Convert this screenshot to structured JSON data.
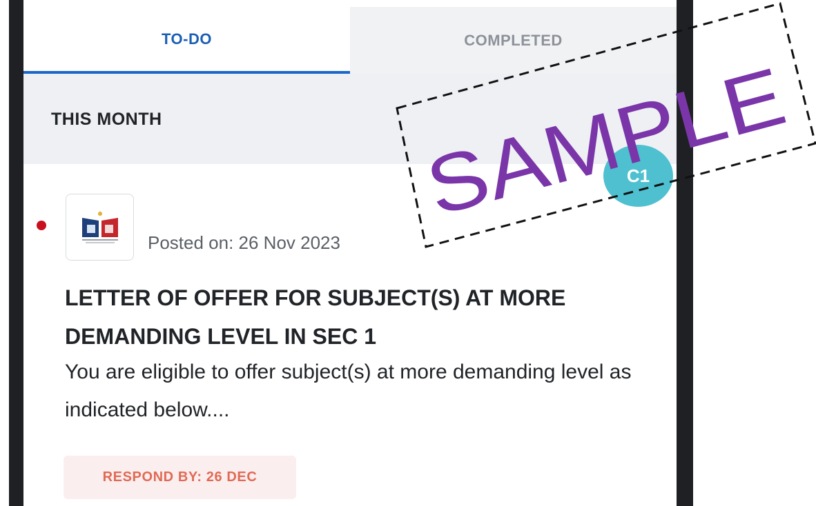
{
  "tabs": [
    {
      "label": "TO-DO",
      "active": true
    },
    {
      "label": "COMPLETED",
      "active": false
    }
  ],
  "section": {
    "title": "THIS MONTH"
  },
  "avatar": {
    "initials": "C1",
    "color": "#4ec0cf"
  },
  "notice": {
    "unread": true,
    "logo_icon": "school-crest-icon",
    "posted": "Posted on: 26 Nov 2023",
    "title": "LETTER OF OFFER FOR SUBJECT(S) AT MORE DEMANDING LEVEL IN SEC 1",
    "description": "You are eligible to offer subject(s) at more demanding level as indicated below....",
    "respond_by": "RESPOND BY: 26 DEC"
  },
  "watermark": {
    "text": "SAMPLE",
    "color": "#7a35a8"
  },
  "colors": {
    "accent": "#1a66c9",
    "unread_dot": "#c8101e",
    "badge_text": "#e06a55",
    "badge_bg": "#fbeeee"
  }
}
